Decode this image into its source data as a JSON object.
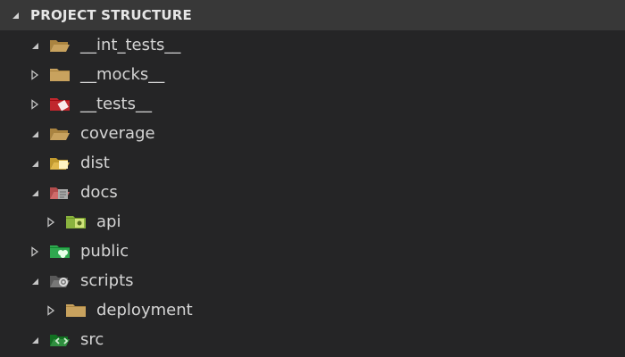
{
  "panel": {
    "title": "PROJECT STRUCTURE",
    "expanded": true
  },
  "tree": [
    {
      "label": "__int_tests__",
      "depth": 0,
      "expanded": true,
      "icon": "folder-open-icon",
      "color": "#c8a25e"
    },
    {
      "label": "__mocks__",
      "depth": 0,
      "expanded": false,
      "icon": "folder-icon",
      "color": "#c8a25e"
    },
    {
      "label": "__tests__",
      "depth": 0,
      "expanded": false,
      "icon": "folder-tests-icon",
      "color": "#c0272d"
    },
    {
      "label": "coverage",
      "depth": 0,
      "expanded": true,
      "icon": "folder-open-icon",
      "color": "#c8a25e"
    },
    {
      "label": "dist",
      "depth": 0,
      "expanded": true,
      "icon": "folder-dist-icon",
      "color": "#e0b84c"
    },
    {
      "label": "docs",
      "depth": 0,
      "expanded": true,
      "icon": "folder-docs-icon",
      "color": "#d06a6a"
    },
    {
      "label": "api",
      "depth": 1,
      "expanded": false,
      "icon": "folder-api-icon",
      "color": "#8ab33f"
    },
    {
      "label": "public",
      "depth": 0,
      "expanded": false,
      "icon": "folder-public-icon",
      "color": "#2fa84f"
    },
    {
      "label": "scripts",
      "depth": 0,
      "expanded": true,
      "icon": "folder-scripts-icon",
      "color": "#777777"
    },
    {
      "label": "deployment",
      "depth": 1,
      "expanded": false,
      "icon": "folder-icon",
      "color": "#c8a25e"
    },
    {
      "label": "src",
      "depth": 0,
      "expanded": true,
      "icon": "folder-src-icon",
      "color": "#2f8f3f"
    }
  ]
}
